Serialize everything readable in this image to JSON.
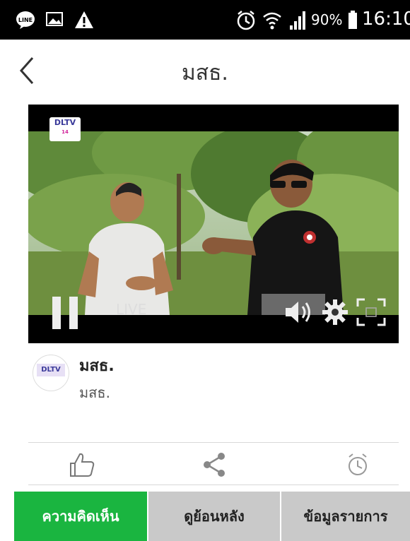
{
  "status_bar": {
    "battery": "90%",
    "time": "16:10",
    "icons": [
      "line-icon",
      "image-icon",
      "warning-icon",
      "alarm-icon",
      "wifi-icon",
      "signal-icon",
      "battery-icon"
    ]
  },
  "header": {
    "title": "มสธ.",
    "back_icon": "chevron-left-icon"
  },
  "video": {
    "live_label": "LIVE",
    "channel_logo": "DLTV",
    "channel_logo_sub": "14",
    "playback_state": "playing"
  },
  "channel": {
    "name": "มสธ.",
    "subtitle": "มสธ."
  },
  "actions": [
    "like-icon",
    "share-icon",
    "alarm-icon"
  ],
  "tabs": [
    {
      "label": "ความคิดเห็น",
      "active": true
    },
    {
      "label": "ดูย้อนหลัง",
      "active": false
    },
    {
      "label": "ข้อมูลรายการ",
      "active": false
    }
  ],
  "colors": {
    "accent": "#1ab540",
    "tab_inactive": "#c9c9c9",
    "status_bar": "#000000"
  }
}
